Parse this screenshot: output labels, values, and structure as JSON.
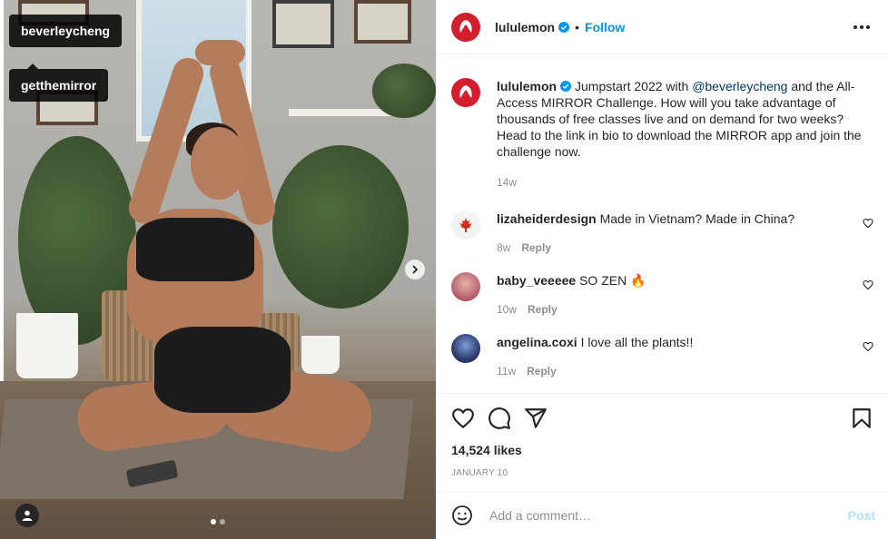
{
  "media": {
    "tags": [
      "beverleycheng",
      "getthemirror"
    ],
    "carousel": {
      "total": 2,
      "active": 0
    }
  },
  "header": {
    "username": "lululemon",
    "separator": "•",
    "follow_label": "Follow"
  },
  "caption": {
    "username": "lululemon",
    "text_before": " Jumpstart 2022 with ",
    "mention": "@beverleycheng",
    "text_after": " and the All-Access MIRROR Challenge. How will you take advantage of thousands of free classes live and on demand for two weeks? Head to the link in bio to download the MIRROR app and join the challenge now.",
    "time": "14w"
  },
  "comments": [
    {
      "username": "lizaheiderdesign",
      "text": "Made in Vietnam? Made in China?",
      "time": "8w",
      "reply_label": "Reply"
    },
    {
      "username": "baby_veeeee",
      "text": "SO ZEN 🔥",
      "time": "10w",
      "reply_label": "Reply"
    },
    {
      "username": "angelina.coxi",
      "text": "I love all the plants!!",
      "time": "11w",
      "reply_label": "Reply"
    }
  ],
  "engagement": {
    "likes": "14,524 likes",
    "date": "JANUARY 10"
  },
  "add_comment": {
    "placeholder": "Add a comment…",
    "post_label": "Post"
  },
  "icons": {
    "like": "heart-icon",
    "comment": "comment-icon",
    "share": "share-icon",
    "save": "bookmark-icon",
    "more": "more-icon",
    "emoji": "emoji-icon",
    "next": "chevron-right-icon",
    "user_tags": "user-icon"
  },
  "colors": {
    "brand": "#d31f2d",
    "link": "#0095f6",
    "mention": "#00376b",
    "muted": "#8e8e8e",
    "post_disabled": "#b2dffc"
  }
}
